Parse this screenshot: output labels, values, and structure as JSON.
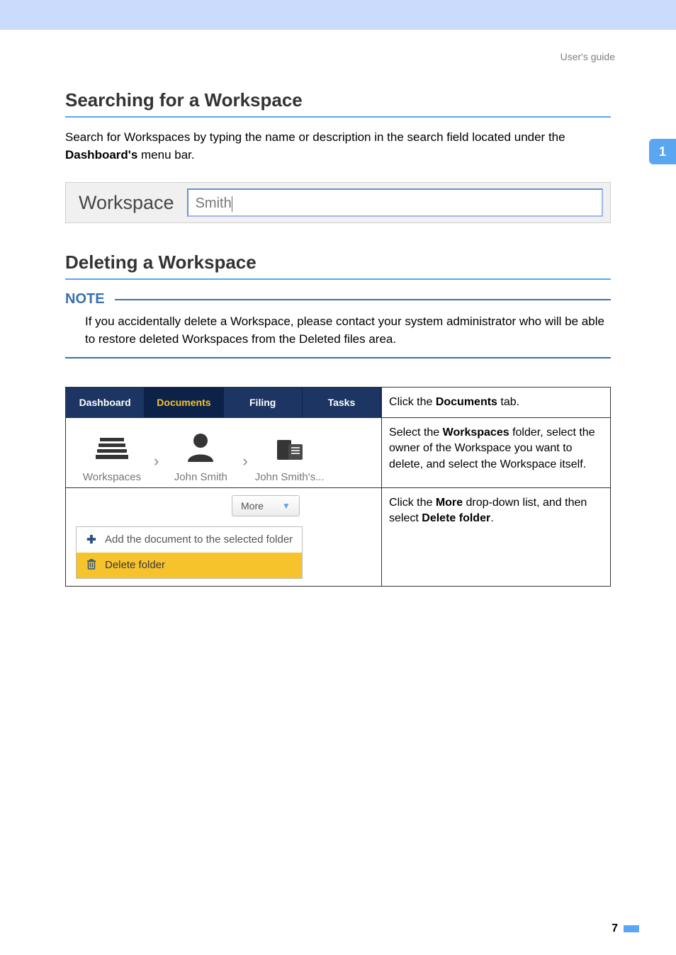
{
  "meta": {
    "header_label": "User's guide",
    "side_tab": "1",
    "page_number": "7"
  },
  "section1": {
    "title": "Searching for a Workspace",
    "para_a": "Search for Workspaces by typing the name or description in the search field located under the ",
    "para_b_bold": "Dashboard's",
    "para_c": " menu bar.",
    "search_label": "Workspace",
    "search_value": "Smith"
  },
  "section2": {
    "title": "Deleting a Workspace",
    "note_label": "NOTE",
    "note_text": "If you accidentally delete a Workspace, please contact your system administrator who will be able to restore deleted Workspaces from the Deleted files area."
  },
  "steps": {
    "row1": {
      "tabs": [
        "Dashboard",
        "Documents",
        "Filing",
        "Tasks"
      ],
      "active_index": 1,
      "text_a": "Click the ",
      "text_b": "Documents",
      "text_c": " tab."
    },
    "row2": {
      "items": [
        "Workspaces",
        "John Smith",
        "John Smith's..."
      ],
      "text_a": "Select the ",
      "text_b": "Workspaces",
      "text_c": " folder, select the owner of the Workspace you want to delete, and select the Workspace itself."
    },
    "row3": {
      "more_label": "More",
      "menu_add": "Add the document to the selected folder",
      "menu_delete": "Delete folder",
      "text_a": "Click the ",
      "text_b": "More",
      "text_c": " drop-down list, and then select ",
      "text_d": "Delete folder",
      "text_e": "."
    }
  }
}
